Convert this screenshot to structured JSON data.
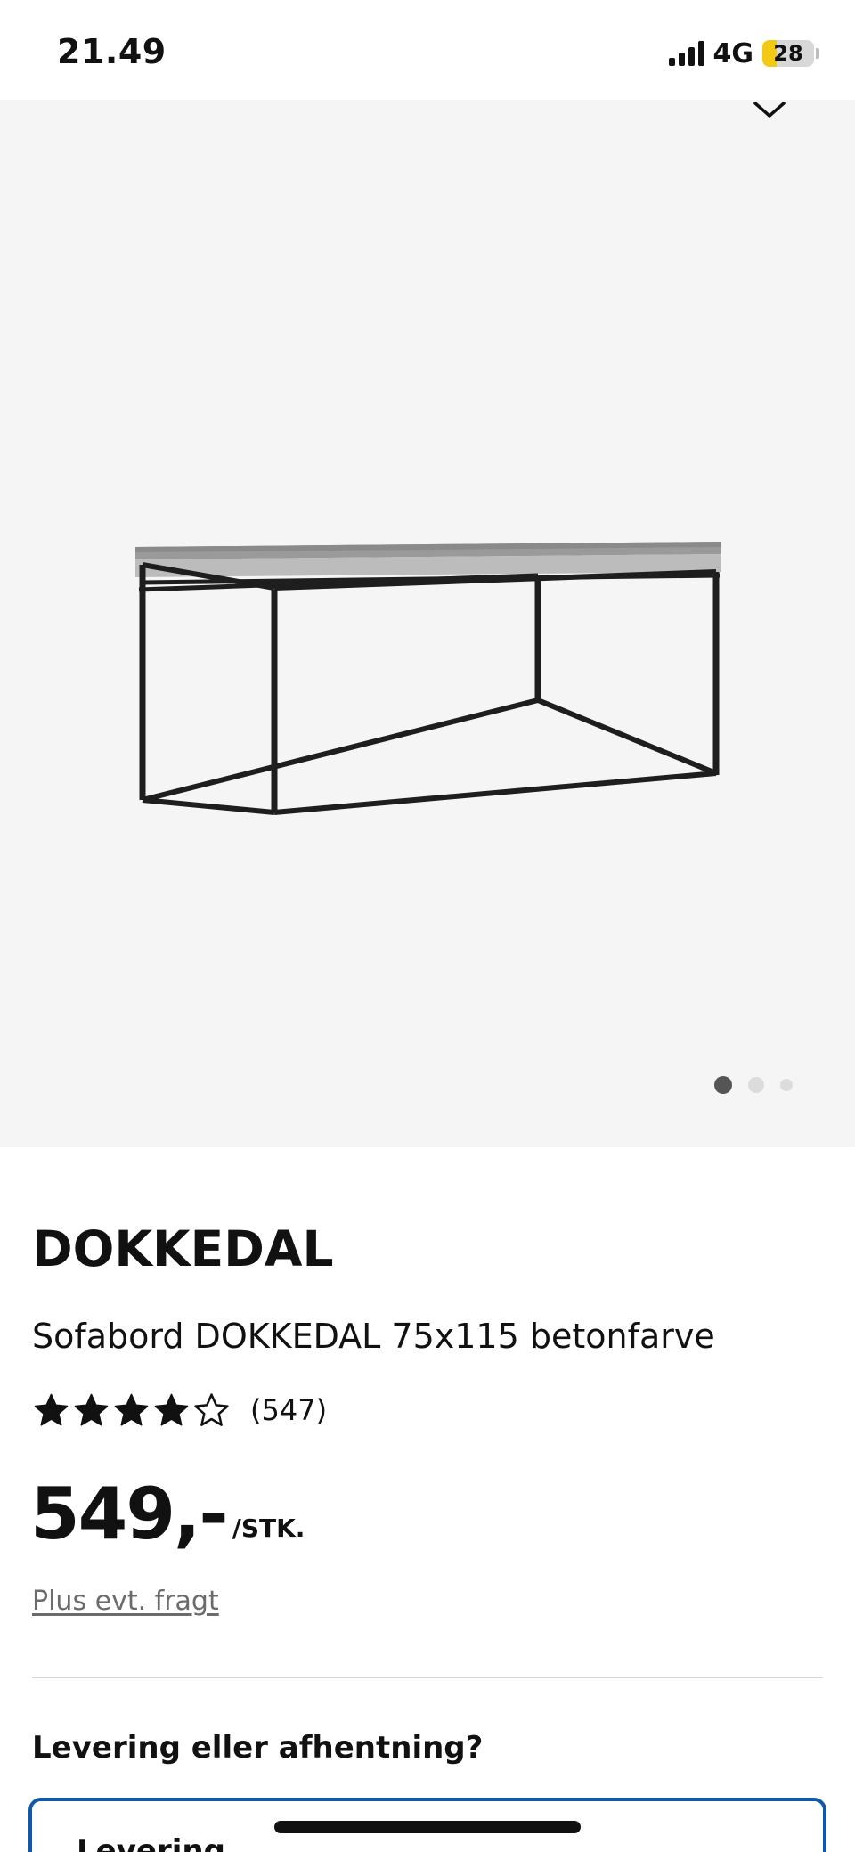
{
  "status_bar": {
    "time": "21.49",
    "network": "4G",
    "battery": "28",
    "battery_level": 0.28
  },
  "gallery": {
    "image_count": 3,
    "active_index": 0
  },
  "product": {
    "brand": "DOKKEDAL",
    "description": "Sofabord DOKKEDAL 75x115 betonfarve",
    "rating": 4,
    "rating_max": 5,
    "review_count": "(547)",
    "price": "549,-",
    "price_unit": "/STK.",
    "freight_note": "Plus evt. fragt"
  },
  "delivery": {
    "heading": "Levering eller afhentning?",
    "option_label": "Levering"
  },
  "colors": {
    "accent_border": "#0f5aa8",
    "hero_background": "#f5f5f5",
    "battery_fill": "#f4c914"
  }
}
